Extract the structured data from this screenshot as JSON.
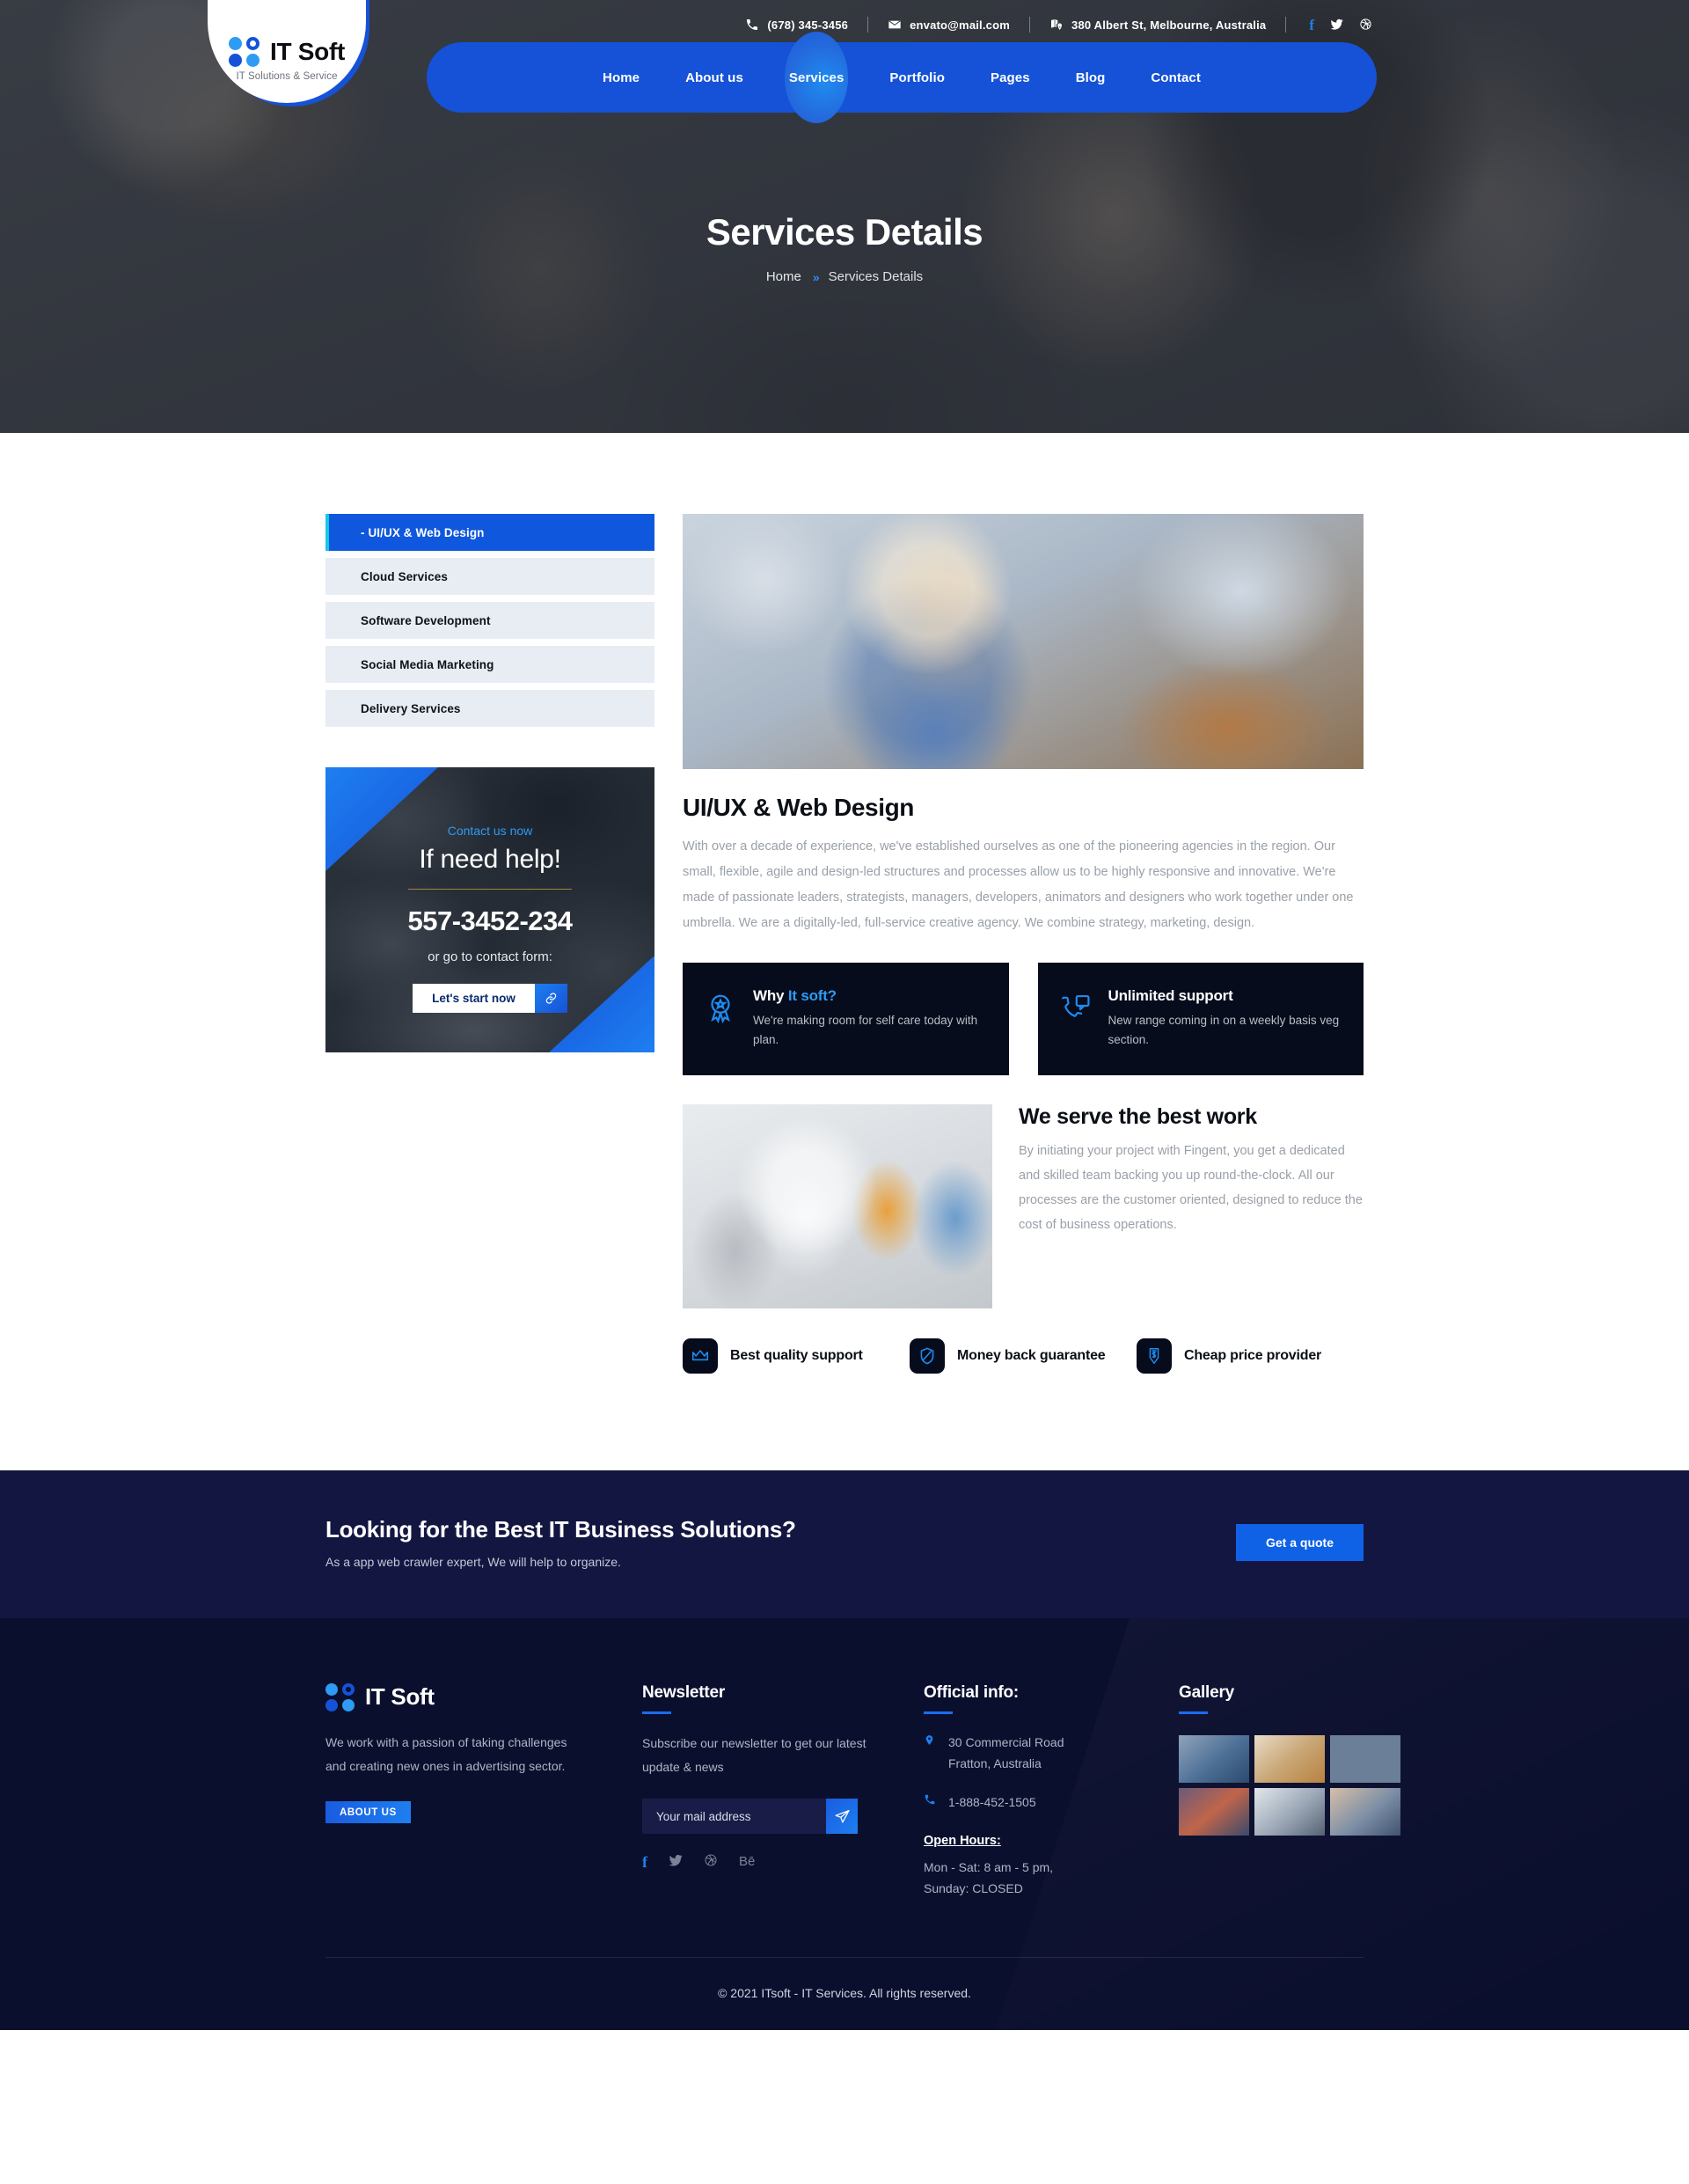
{
  "topbar": {
    "phone": "(678) 345-3456",
    "email": "envato@mail.com",
    "address": "380 Albert St, Melbourne, Australia",
    "socials": [
      {
        "name": "facebook-icon",
        "glyph": "f"
      },
      {
        "name": "twitter-icon",
        "glyph": "🐦"
      },
      {
        "name": "dribbble-icon",
        "glyph": "◎"
      }
    ]
  },
  "brand": {
    "name": "IT Soft",
    "tagline": "IT Solutions & Service"
  },
  "nav": {
    "items": [
      {
        "label": "Home",
        "active": false
      },
      {
        "label": "About us",
        "active": false
      },
      {
        "label": "Services",
        "active": true
      },
      {
        "label": "Portfolio",
        "active": false
      },
      {
        "label": "Pages",
        "active": false
      },
      {
        "label": "Blog",
        "active": false
      },
      {
        "label": "Contact",
        "active": false
      }
    ]
  },
  "hero": {
    "title": "Services Details",
    "crumb_home": "Home",
    "crumb_arrow": "»",
    "crumb_current": "Services Details"
  },
  "services_sidebar": {
    "items": [
      {
        "label": "- UI/UX & Web Design",
        "active": true
      },
      {
        "label": "Cloud Services",
        "active": false
      },
      {
        "label": "Software Development",
        "active": false
      },
      {
        "label": "Social Media Marketing",
        "active": false
      },
      {
        "label": "Delivery Services",
        "active": false
      }
    ]
  },
  "help_card": {
    "eyebrow": "Contact us now",
    "heading": "If need help!",
    "phone": "557-3452-234",
    "sub": "or go to contact form:",
    "button": "Let's start now",
    "button_icon": "🔗"
  },
  "service_detail": {
    "title": "UI/UX & Web Design",
    "paragraph": "With over a decade of experience, we've established ourselves as one of the pioneering agencies in the region. Our small, flexible, agile and design-led structures and processes allow us to be highly responsive and innovative. We're made of passionate leaders, strategists, managers, developers, animators and designers who work together under one umbrella. We are a digitally-led, full-service creative agency. We combine strategy, marketing, design."
  },
  "info_cards": [
    {
      "icon": "award-badge-icon",
      "title_plain": "Why ",
      "title_accent": "It soft?",
      "text": "We're making room for self care today with plan."
    },
    {
      "icon": "phone-chat-icon",
      "title_plain": "Unlimited support",
      "title_accent": "",
      "text": "New range coming in on a weekly basis veg section."
    }
  ],
  "serve": {
    "title": "We serve the best work",
    "text": "By initiating your project with Fingent, you get a dedicated and skilled team backing you up round-the-clock. All our processes are  the customer oriented, designed to reduce the cost of business operations."
  },
  "features": [
    {
      "icon": "crown-icon",
      "label": "Best quality support"
    },
    {
      "icon": "shield-icon",
      "label": "Money back guarantee"
    },
    {
      "icon": "price-down-icon",
      "label": "Cheap price provider"
    }
  ],
  "cta": {
    "heading": "Looking for the Best IT Business Solutions?",
    "sub": "As a app web crawler expert, We will help to organize.",
    "button": "Get a quote"
  },
  "footer": {
    "brand": "IT Soft",
    "about": "We work with a passion of taking challenges and creating new ones in advertising sector.",
    "about_button": "ABOUT US",
    "newsletter": {
      "heading": "Newsletter",
      "text": "Subscribe our newsletter to get our latest update & news",
      "placeholder": "Your mail address",
      "send_icon": "send-icon"
    },
    "socials": [
      {
        "name": "facebook-icon",
        "glyph": "f"
      },
      {
        "name": "twitter-icon",
        "glyph": "🐦"
      },
      {
        "name": "dribbble-icon",
        "glyph": "◎"
      },
      {
        "name": "behance-icon",
        "glyph": "Bē"
      }
    ],
    "official": {
      "heading": "Official info:",
      "address_line1": "30 Commercial Road",
      "address_line2": "Fratton, Australia",
      "phone": "1-888-452-1505",
      "hours_title": "Open Hours:",
      "hours_line1": "Mon - Sat: 8 am - 5 pm,",
      "hours_line2": "Sunday: CLOSED"
    },
    "gallery": {
      "heading": "Gallery",
      "count": 6
    },
    "copyright": "© 2021 ITsoft - IT Services. All rights reserved."
  },
  "colors": {
    "primary": "#1552d8",
    "accent": "#2e9bf5",
    "dark": "#060c1c",
    "footer": "#0b0f2e",
    "cta": "#141642"
  }
}
